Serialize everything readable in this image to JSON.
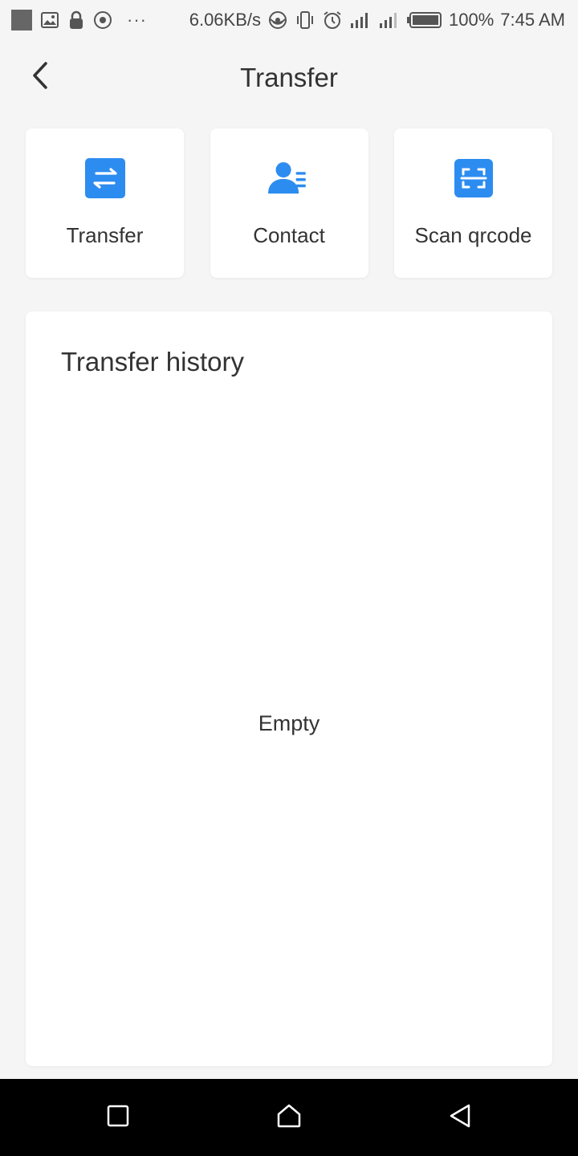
{
  "status_bar": {
    "network_speed": "6.06KB/s",
    "dots": "···",
    "battery": "100%",
    "time": "7:45 AM",
    "icons": [
      "notification-square-icon",
      "gallery-icon",
      "lock-icon",
      "target-icon",
      "hotspot-icon",
      "vibrate-icon",
      "alarm-icon",
      "signal-icon",
      "signal-icon-2",
      "battery-icon"
    ]
  },
  "header": {
    "title": "Transfer",
    "back_icon": "chevron-left-icon"
  },
  "actions": [
    {
      "label": "Transfer",
      "icon": "transfer-arrows-icon"
    },
    {
      "label": "Contact",
      "icon": "contact-icon"
    },
    {
      "label": "Scan qrcode",
      "icon": "scan-icon"
    }
  ],
  "history": {
    "title": "Transfer history",
    "empty_text": "Empty"
  },
  "nav": {
    "icons": [
      "recents-square-icon",
      "home-icon",
      "back-triangle-icon"
    ]
  },
  "colors": {
    "accent": "#2d8cf0",
    "background": "#f5f5f5",
    "card": "#ffffff",
    "nav_bar": "#000000"
  }
}
